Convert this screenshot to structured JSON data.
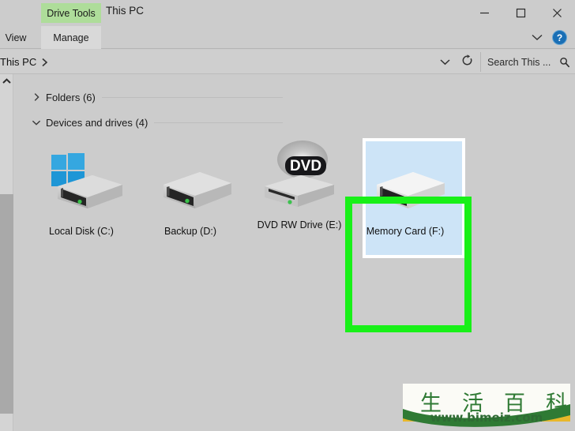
{
  "window": {
    "title": "This PC",
    "contextual_tab_group": "Drive Tools",
    "minimize_icon": "minimize-icon",
    "maximize_icon": "maximize-icon",
    "close_icon": "close-icon"
  },
  "ribbon": {
    "tabs": [
      {
        "label": "View",
        "name": "tab-view",
        "active": false
      },
      {
        "label": "Manage",
        "name": "tab-manage",
        "active": true
      }
    ],
    "collapse_icon": "chevron-down-icon",
    "help_label": "?",
    "help_icon": "help-icon"
  },
  "address_bar": {
    "breadcrumb": "This PC",
    "breadcrumb_separator_icon": "chevron-right-icon",
    "history_dropdown_icon": "chevron-down-icon",
    "refresh_icon": "refresh-icon",
    "search_placeholder": "Search This ...",
    "search_icon": "search-icon"
  },
  "content": {
    "groups": [
      {
        "label": "Folders (6)",
        "count": 6,
        "expanded": false,
        "chevron_icon": "chevron-right-icon"
      },
      {
        "label": "Devices and drives (4)",
        "count": 4,
        "expanded": true,
        "chevron_icon": "chevron-down-icon"
      }
    ],
    "drives": [
      {
        "label": "Local Disk (C:)",
        "icon": "hard-drive-icon",
        "badge": "windows-logo-badge",
        "selected": false
      },
      {
        "label": "Backup (D:)",
        "icon": "hard-drive-icon",
        "badge": null,
        "selected": false
      },
      {
        "label": "DVD RW Drive (E:)",
        "icon": "dvd-drive-icon",
        "badge": "DVD",
        "selected": false
      },
      {
        "label": "Memory Card (F:)",
        "icon": "hard-drive-icon",
        "badge": null,
        "selected": true
      }
    ]
  },
  "scrollbar": {
    "up_arrow_icon": "chevron-up-icon"
  },
  "annotation": {
    "highlight_target": "Memory Card (F:)",
    "highlight_color": "#18f018"
  },
  "watermark": {
    "cjk_chars": [
      "生",
      "活",
      "百",
      "科"
    ],
    "url": "www.bimeiz.com"
  },
  "colors": {
    "window_bg": "#cccccc",
    "addressbar_bg": "#cfcfcf",
    "contextual_tab_green": "#aedd9a",
    "selection_blue": "#cde4f7",
    "highlight_green": "#18f018",
    "help_blue": "#1a6fb5",
    "scrollbar_thumb": "#a9a9a9",
    "watermark_green": "#2f7a34"
  }
}
